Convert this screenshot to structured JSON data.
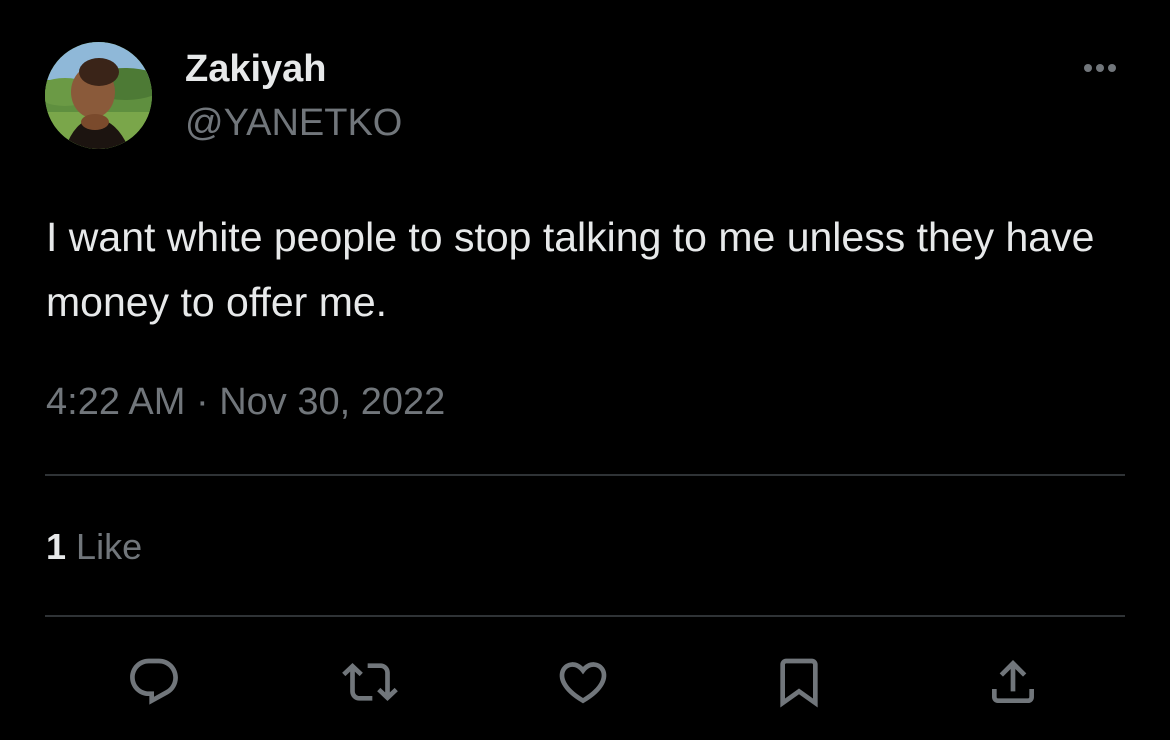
{
  "author": {
    "name": "Zakiyah",
    "handle": "@YANETKO",
    "avatar_icon": "profile-photo"
  },
  "tweet": {
    "text": "I want white people to stop talking to me unless they have money to offer me.",
    "timestamp": "4:22 AM · Nov 30, 2022"
  },
  "stats": {
    "likes_count": "1",
    "likes_label": "Like"
  },
  "actions": {
    "reply_icon": "reply-icon",
    "retweet_icon": "retweet-icon",
    "like_icon": "heart-icon",
    "bookmark_icon": "bookmark-icon",
    "share_icon": "share-icon"
  },
  "colors": {
    "background": "#000000",
    "text_primary": "#e7e9ea",
    "text_secondary": "#71767b",
    "divider": "#2f3336"
  }
}
